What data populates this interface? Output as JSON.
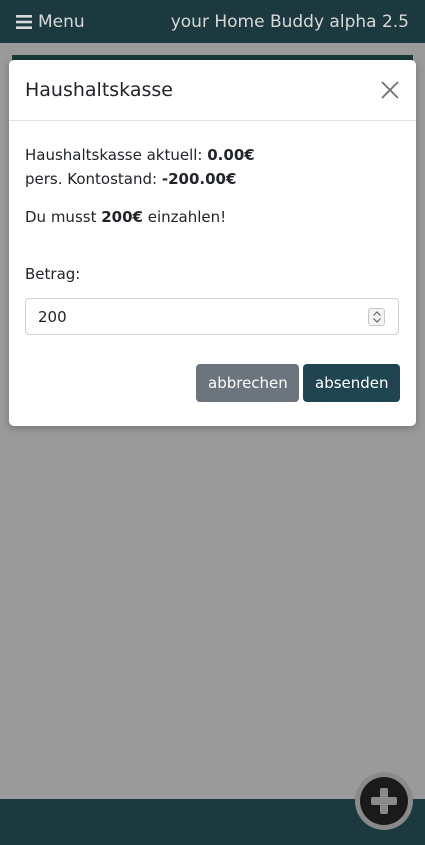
{
  "navbar": {
    "menu_label": "Menu",
    "brand": "your Home Buddy alpha 2.5"
  },
  "modal": {
    "title": "Haushaltskasse",
    "lines": {
      "kasse_label": "Haushaltskasse aktuell: ",
      "kasse_value": "0.00€",
      "konto_label": "pers. Kontostand: ",
      "konto_value": "-200.00€"
    },
    "notice": {
      "prefix": "Du musst ",
      "amount": "200€",
      "suffix": " einzahlen!"
    },
    "amount_label": "Betrag:",
    "amount_value": "200",
    "buttons": {
      "cancel": "abbrechen",
      "submit": "absenden"
    }
  },
  "icons": {
    "menu": "hamburger-icon",
    "close": "close-icon",
    "fab": "plus-circle-icon"
  },
  "colors": {
    "navbar": "#1c3940",
    "submit_button": "#1f4650",
    "cancel_button": "#6c757d"
  }
}
